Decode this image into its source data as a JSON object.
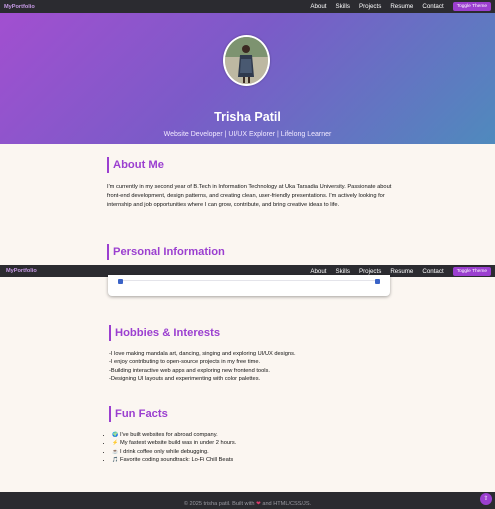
{
  "brand": "MyPortfolio",
  "nav": {
    "links": [
      "About",
      "Skills",
      "Projects",
      "Resume",
      "Contact"
    ],
    "toggle_label": "Toggle Theme"
  },
  "hero": {
    "name": "Trisha Patil",
    "tagline": "Website Developer | UI/UX Explorer | Lifelong Learner"
  },
  "about": {
    "heading": "About Me",
    "paragraph": "I'm currently in my second year of B.Tech in Information Technology at Uka Tarsadia University. Passionate about front-end development, design patterns, and creating clean, user-friendly presentations. I'm actively looking for internship and job opportunities where I can grow, contribute, and bring creative ideas to life."
  },
  "personal": {
    "heading": "Personal Information"
  },
  "hobbies": {
    "heading": "Hobbies & Interests",
    "items": [
      "-I love making mandala art, dancing, singing and exploring UI/UX designs.",
      "-I enjoy contributing to open-source projects in my free time.",
      "-Building interactive web apps and exploring new frontend tools.",
      "-Designing UI layouts and experimenting with color palettes."
    ]
  },
  "fun_facts": {
    "heading": "Fun Facts",
    "items": [
      {
        "icon": "globe-icon",
        "glyph": "🌍",
        "text": "I've built websites for abroad company."
      },
      {
        "icon": "lightning-icon",
        "glyph": "⚡",
        "text": "My fastest website build was in under 2 hours."
      },
      {
        "icon": "coffee-icon",
        "glyph": "☕",
        "text": "I drink coffee only while debugging."
      },
      {
        "icon": "music-icon",
        "glyph": "🎵",
        "text": "Favorite coding soundtrack: Lo-Fi Chill Beats"
      }
    ]
  },
  "footer": {
    "text_before": "© 2025 trisha patil. Built with",
    "text_after": "and HTML/CSS/JS."
  },
  "scroll_top_glyph": "⇧",
  "colors": {
    "accent": "#9b3fd0",
    "nav_bg": "#2b2b30",
    "page_bg": "#fbf6f1"
  }
}
